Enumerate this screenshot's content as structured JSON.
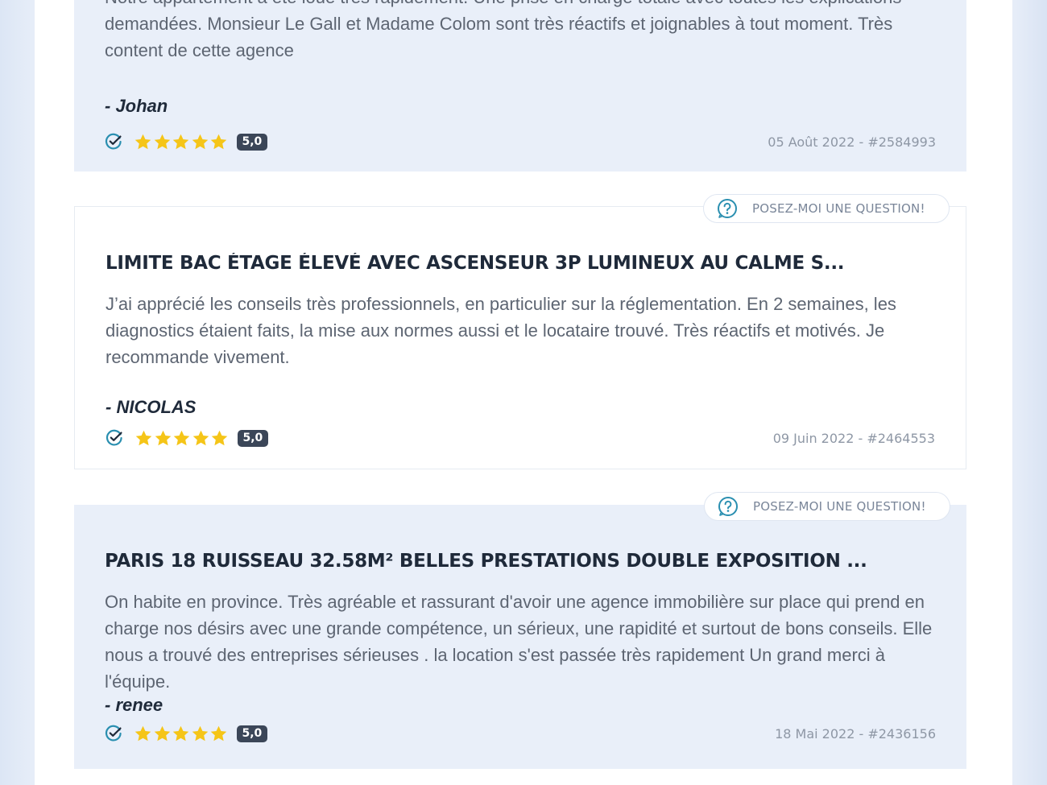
{
  "reviews": [
    {
      "title": "",
      "text": "Notre appartement a été loué très rapidement. Une prise en charge totale avec toutes les explications demandées. Monsieur Le Gall et Madame Colom sont très réactifs et joignables à tout moment. Très content de cette agence",
      "author": "- Johan",
      "score": "5,0",
      "meta": "05 Août 2022 - #2584993"
    },
    {
      "ask_label": "POSEZ-MOI UNE QUESTION!",
      "title": "LIMITE BAC ÉTAGE ÉLEVÉ AVEC ASCENSEUR 3P LUMINEUX AU CALME S...",
      "text": "J’ai apprécié les conseils très professionnels, en particulier sur la réglementation. En 2 semaines, les diagnostics étaient faits, la mise aux normes aussi et le locataire trouvé. Très réactifs et motivés. Je recommande vivement.",
      "author": "- NICOLAS",
      "score": "5,0",
      "meta": "09 Juin 2022 - #2464553"
    },
    {
      "ask_label": "POSEZ-MOI UNE QUESTION!",
      "title": "PARIS 18 RUISSEAU 32.58M² BELLES PRESTATIONS DOUBLE EXPOSITION ...",
      "text": "On habite en province. Très agréable et rassurant d'avoir une agence immobilière sur place qui prend en charge nos désirs avec une grande compétence, un sérieux, une rapidité et surtout de bons conseils. Elle nous a trouvé des entreprises sérieuses . la location s'est passée très rapidement Un grand merci à l'équipe.",
      "author": "- renee",
      "score": "5,0",
      "meta": "18 Mai 2022 - #2436156"
    }
  ],
  "star_rating": 5,
  "colors": {
    "accent": "#2a8fb0",
    "star": "#f5c518",
    "verified": "#2a8fb0",
    "badge": "#3b4658"
  },
  "icons": {
    "question": "question-circle-icon",
    "verified": "verified-check-icon",
    "star": "star-icon"
  }
}
